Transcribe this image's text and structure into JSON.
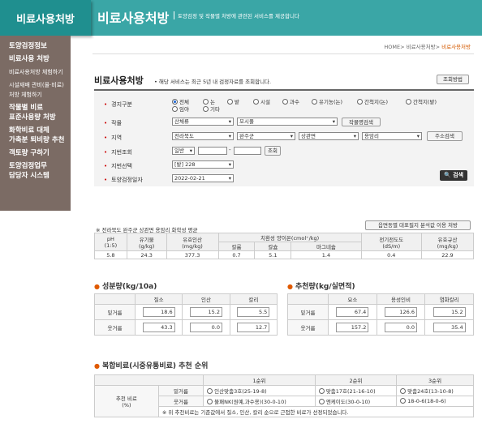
{
  "header": {
    "logo": "비료사용처방",
    "title": "비료사용처방",
    "subtitle": "토양검정 및 작물별 처방에 관련된 서비스를 제공합니다"
  },
  "sidebar": {
    "items": [
      {
        "label": "토양검정정보",
        "small": false
      },
      {
        "label": "비료사용 처방",
        "small": false
      },
      {
        "label": "비료사용처방 체험하기",
        "small": true
      },
      {
        "label": "시설재배 관비(물·비료)",
        "small": true
      },
      {
        "label": "처방 체험하기",
        "small": true
      },
      {
        "label": "작물별 비료",
        "small": false
      },
      {
        "label": "표준사용량 처방",
        "small": false
      },
      {
        "label": "화학비료 대체",
        "small": false
      },
      {
        "label": "가축분 퇴비량 추천",
        "small": false
      },
      {
        "label": "객토량 구하기",
        "small": false
      },
      {
        "label": "토양검정업무",
        "small": false
      },
      {
        "label": "담당자 시스템",
        "small": false
      }
    ]
  },
  "breadcrumb": {
    "home": "HOME",
    "mid": "비료사용처방",
    "current": "비료사용처방",
    "sep": ">"
  },
  "section": {
    "title": "비료사용처방",
    "note": "• 해당 서비스는 최근 5년 내 검정자료를 조회합니다.",
    "method_button": "조회방법"
  },
  "form": {
    "labels": {
      "land": "경지구분",
      "crop": "작물",
      "region": "지역",
      "lot": "지번조회",
      "lot_select": "지번선택",
      "date": "토양검정일자"
    },
    "land_options": [
      "전체",
      "논",
      "밭",
      "시설",
      "과수",
      "유기농(논)",
      "간척지(논)",
      "간척지(밭)",
      "임야",
      "기타"
    ],
    "crop1": "산채류",
    "crop2": "모시풀",
    "crop_search": "작물명검색",
    "region": [
      "전라북도",
      "완주군",
      "상관면",
      "용암리"
    ],
    "address_search": "주소검색",
    "lot_type": "일반",
    "lot_dash": "-",
    "lot_search": "조회",
    "lot_value": "[밭] 228",
    "date_value": "2022-02-21",
    "search": "검색"
  },
  "chem": {
    "note": "※ 전라북도 완주군 상관면 용암리 화학성 평균",
    "ratio_button": "읍면동별 대표필지 분석값 이용 처방",
    "headers": [
      "pH\n(1:5)",
      "유기물\n(g/kg)",
      "유효인산\n(mg/kg)",
      "치환성 양이온(cmol⁺/kg)",
      "전기전도도\n(dS/m)",
      "유효규산\n(mg/kg)"
    ],
    "cations": [
      "칼륨",
      "칼슘",
      "마그네슘"
    ],
    "values": [
      "5.8",
      "24.3",
      "377.3",
      "0.7",
      "5.1",
      "1.4",
      "0.4",
      "22.9"
    ]
  },
  "ingredient": {
    "title": "성분량(kg/10a)",
    "cols": [
      "질소",
      "인산",
      "칼리"
    ],
    "rows": [
      {
        "label": "밑거름",
        "values": [
          "18.6",
          "15.2",
          "5.5"
        ]
      },
      {
        "label": "웃거름",
        "values": [
          "43.3",
          "0.0",
          "12.7"
        ]
      }
    ]
  },
  "recommend": {
    "title": "추천량(kg/실면적)",
    "cols": [
      "요소",
      "용성인비",
      "염화칼리"
    ],
    "rows": [
      {
        "label": "밑거름",
        "values": [
          "67.4",
          "126.6",
          "15.2"
        ]
      },
      {
        "label": "웃거름",
        "values": [
          "157.2",
          "0.0",
          "35.4"
        ]
      }
    ]
  },
  "compound": {
    "title": "복합비료(시중유통비료) 추천 순위",
    "ranks": [
      "1순위",
      "2순위",
      "3순위"
    ],
    "row_label": "추천 비료\n(%)",
    "rows": [
      {
        "label": "밑거름",
        "items": [
          "인산맞춤3호(25-19-8)",
          "맞춤17호(21-16-10)",
          "맞춤24호(13-10-8)"
        ]
      },
      {
        "label": "웃거름",
        "items": [
          "불패NK(원예,과수용)(30-0-10)",
          "엔케이도(30-0-10)",
          "18-0-6(18-0-6)"
        ]
      }
    ],
    "footnote": "※ 위 추천비료는 기준값에서 질소, 인산, 칼리 순으로 근접한 비료가 선정되었습니다."
  }
}
